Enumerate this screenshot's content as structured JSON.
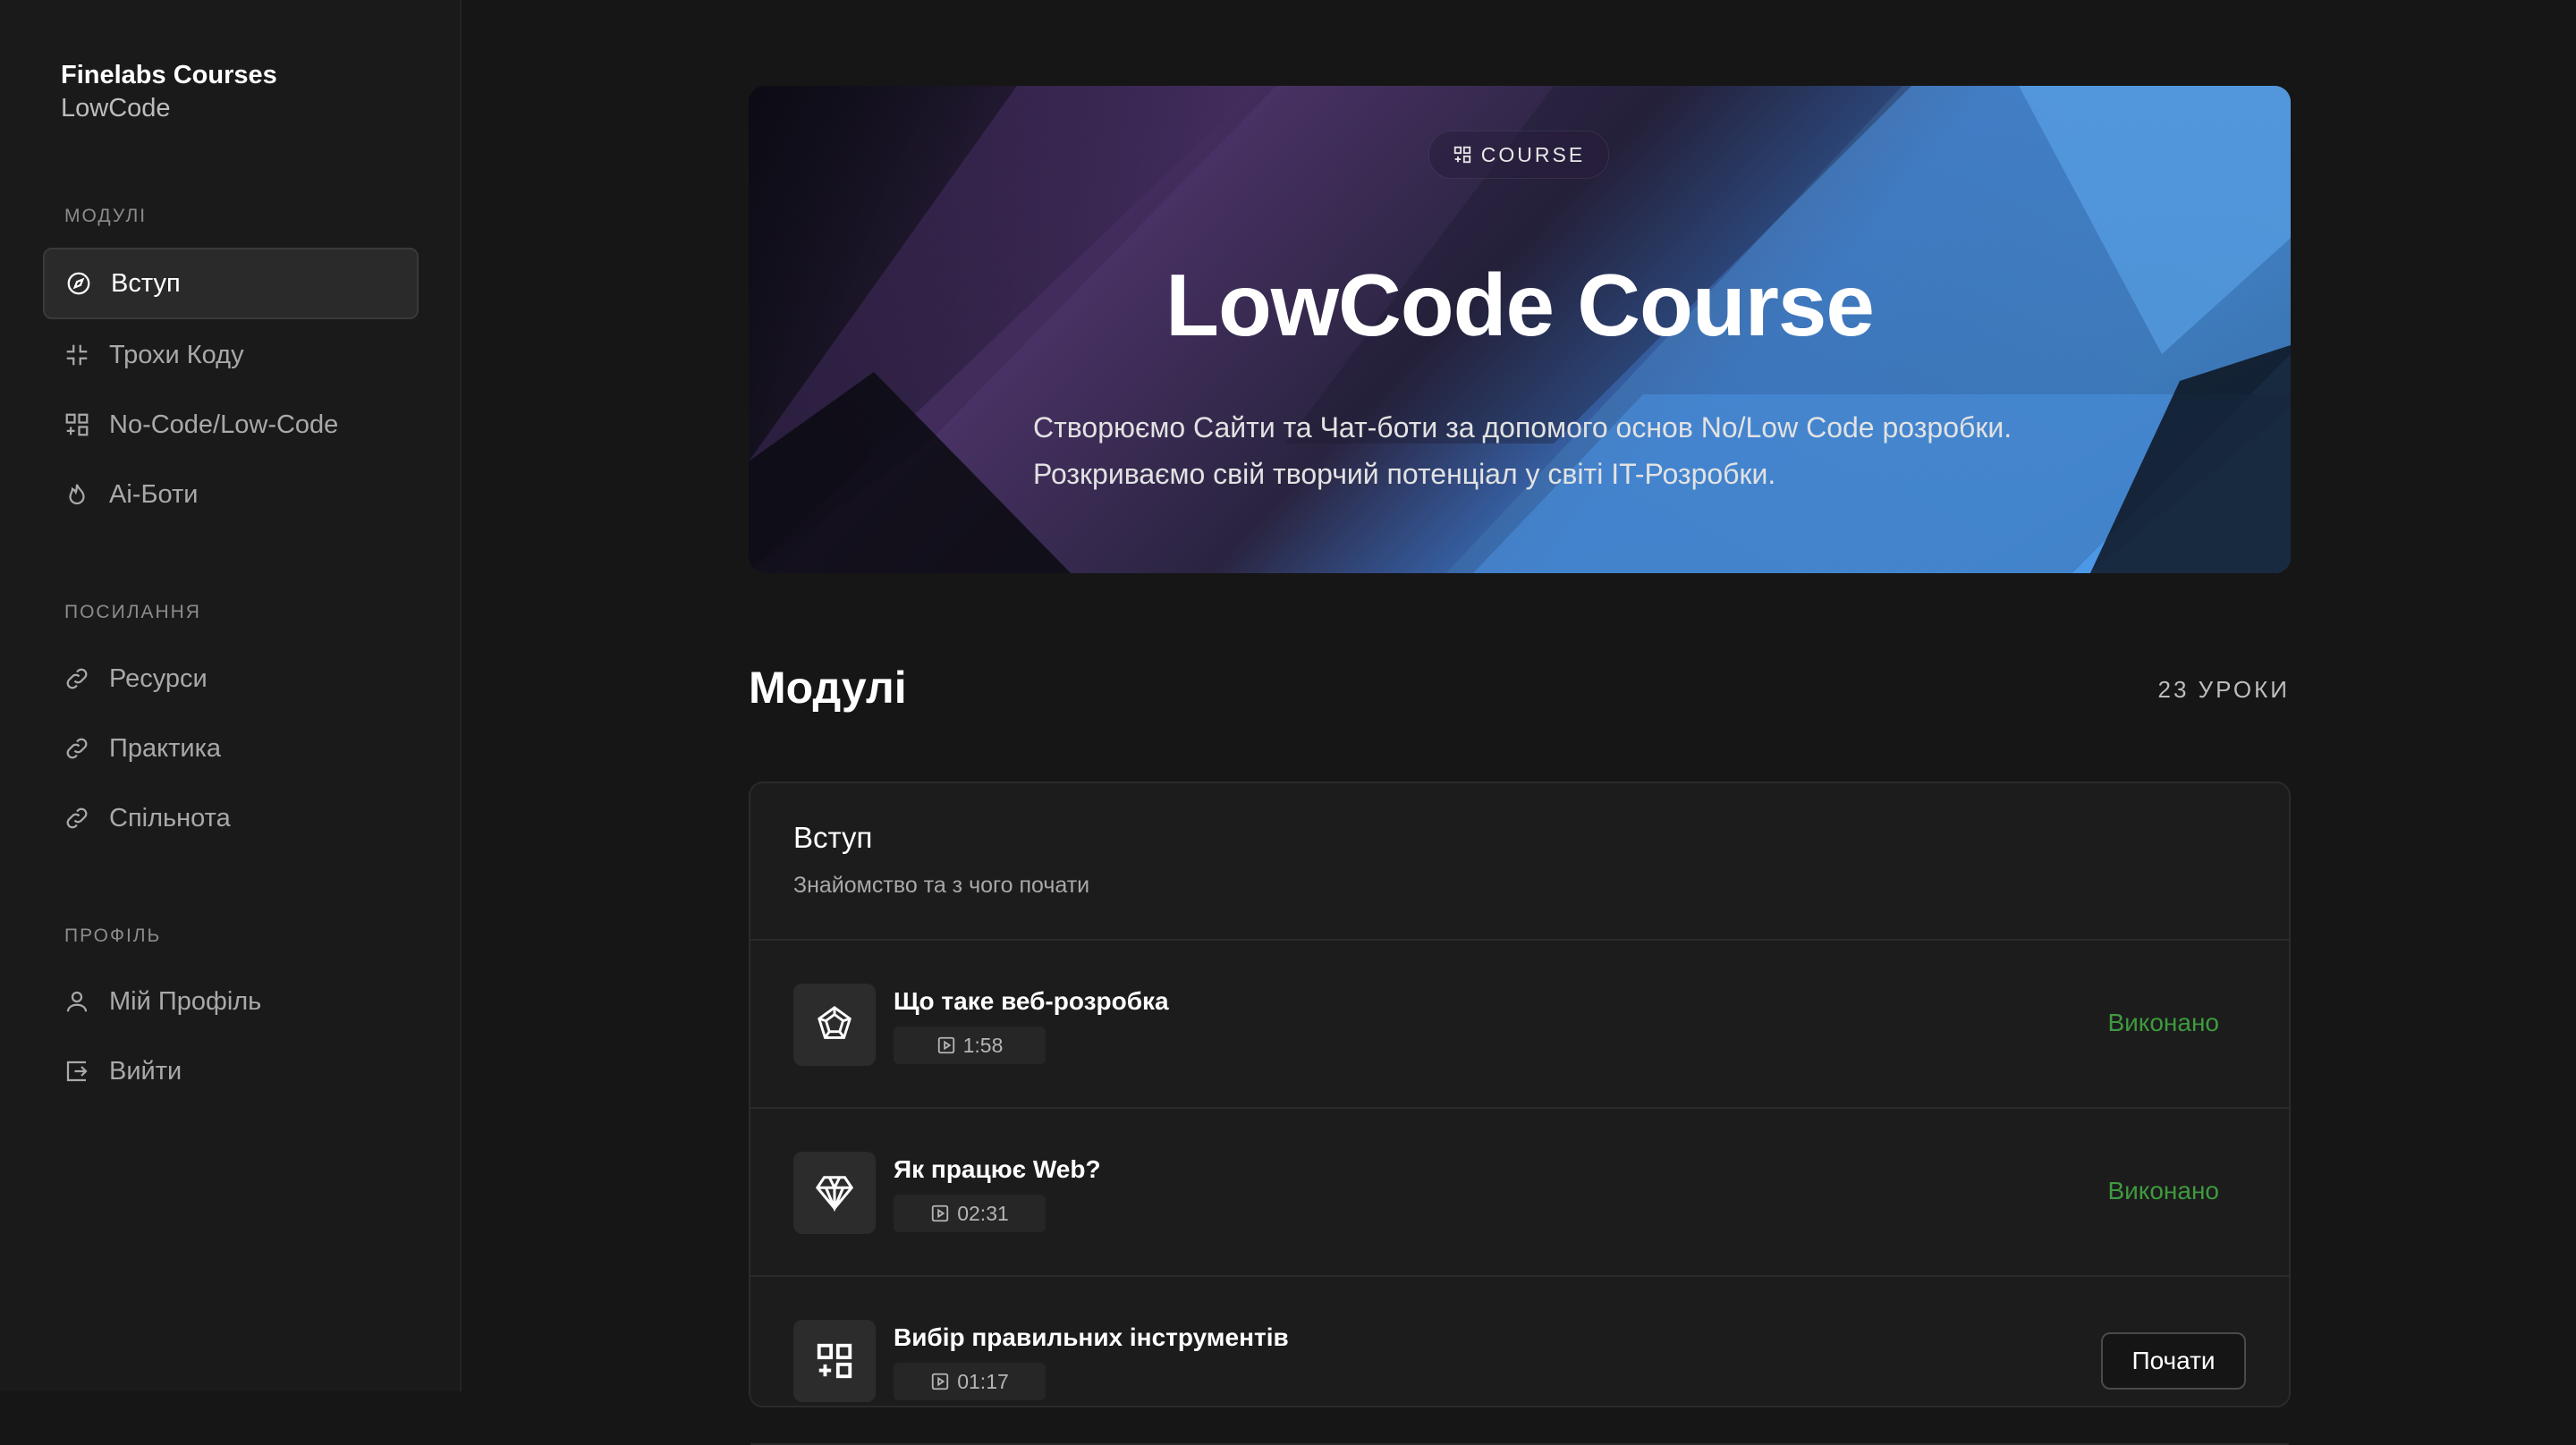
{
  "brand": {
    "name": "Finelabs Courses",
    "subtitle": "LowCode"
  },
  "sidebar": {
    "sections": [
      {
        "label": "МОДУЛІ",
        "items": [
          {
            "label": "Вступ",
            "icon": "compass-icon",
            "active": true
          },
          {
            "label": "Трохи Коду",
            "icon": "shrink-icon"
          },
          {
            "label": "No-Code/Low-Code",
            "icon": "grid-plus-icon"
          },
          {
            "label": "Ai-Боти",
            "icon": "flame-icon"
          }
        ]
      },
      {
        "label": "ПОСИЛАННЯ",
        "items": [
          {
            "label": "Ресурси",
            "icon": "link-icon"
          },
          {
            "label": "Практика",
            "icon": "link-icon"
          },
          {
            "label": "Спільнота",
            "icon": "link-icon"
          }
        ]
      },
      {
        "label": "ПРОФІЛЬ",
        "items": [
          {
            "label": "Мій Профіль",
            "icon": "user-icon"
          },
          {
            "label": "Вийти",
            "icon": "logout-icon"
          }
        ]
      }
    ]
  },
  "hero": {
    "badge": "COURSE",
    "title": "LowCode Course",
    "description": "Створюємо Сайти та Чат-боти за допомого основ No/Low Code розробки. Розкриваємо свій творчий потенціал у світі IT-Розробки."
  },
  "modules": {
    "title": "Модулі",
    "lessons_count": "23 УРОКИ",
    "module": {
      "name": "Вступ",
      "description": "Знайомство та з чого почати",
      "lessons": [
        {
          "title": "Що таке веб-розробка",
          "duration": "1:58",
          "status": "Виконано",
          "icon": "web-icon"
        },
        {
          "title": "Як працює Web?",
          "duration": "02:31",
          "status": "Виконано",
          "icon": "diamond-icon"
        },
        {
          "title": "Вибір правильних інструментів",
          "duration": "01:17",
          "action": "Почати",
          "icon": "grid-plus-icon"
        }
      ]
    }
  },
  "colors": {
    "background": "#161616",
    "sidebar": "#1a1a1a",
    "status_done": "#3f9a3f"
  }
}
